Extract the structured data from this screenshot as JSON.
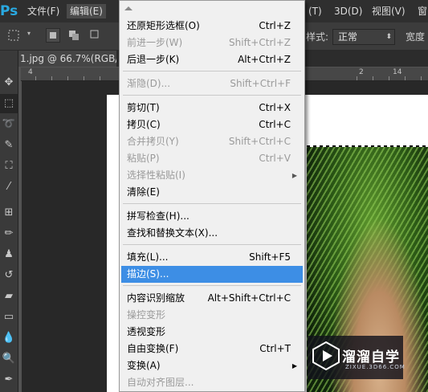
{
  "app": {
    "logo": "Ps",
    "menubar": [
      {
        "label": "文件(F)",
        "active": false
      },
      {
        "label": "编辑(E)",
        "active": true
      },
      {
        "label": "(T)",
        "active": false
      },
      {
        "label": "3D(D)",
        "active": false
      },
      {
        "label": "视图(V)",
        "active": false
      },
      {
        "label": "窗",
        "active": false
      }
    ]
  },
  "options_bar": {
    "style_label": "样式:",
    "style_value": "正常",
    "width_label": "宽度"
  },
  "document": {
    "tab_title": "1.jpg @ 66.7%(RGB/"
  },
  "ruler": {
    "numbers": [
      "4",
      "2",
      "14"
    ]
  },
  "edit_menu": {
    "items": [
      {
        "label": "还原矩形选框(O)",
        "shortcut": "Ctrl+Z",
        "disabled": false
      },
      {
        "label": "前进一步(W)",
        "shortcut": "Shift+Ctrl+Z",
        "disabled": true
      },
      {
        "label": "后退一步(K)",
        "shortcut": "Alt+Ctrl+Z",
        "disabled": false
      },
      {
        "label": "渐隐(D)...",
        "shortcut": "Shift+Ctrl+F",
        "disabled": true
      },
      {
        "label": "剪切(T)",
        "shortcut": "Ctrl+X",
        "disabled": false
      },
      {
        "label": "拷贝(C)",
        "shortcut": "Ctrl+C",
        "disabled": false
      },
      {
        "label": "合并拷贝(Y)",
        "shortcut": "Shift+Ctrl+C",
        "disabled": true
      },
      {
        "label": "粘贴(P)",
        "shortcut": "Ctrl+V",
        "disabled": true
      },
      {
        "label": "选择性粘贴(I)",
        "shortcut": "",
        "disabled": true,
        "submenu": true
      },
      {
        "label": "清除(E)",
        "shortcut": "",
        "disabled": false
      },
      {
        "label": "拼写检查(H)...",
        "shortcut": "",
        "disabled": false
      },
      {
        "label": "查找和替换文本(X)...",
        "shortcut": "",
        "disabled": false
      },
      {
        "label": "填充(L)...",
        "shortcut": "Shift+F5",
        "disabled": false
      },
      {
        "label": "描边(S)...",
        "shortcut": "",
        "disabled": false,
        "highlighted": true
      },
      {
        "label": "内容识别缩放",
        "shortcut": "Alt+Shift+Ctrl+C",
        "disabled": false
      },
      {
        "label": "操控变形",
        "shortcut": "",
        "disabled": true
      },
      {
        "label": "透视变形",
        "shortcut": "",
        "disabled": false
      },
      {
        "label": "自由变换(F)",
        "shortcut": "Ctrl+T",
        "disabled": false
      },
      {
        "label": "变换(A)",
        "shortcut": "",
        "disabled": false,
        "submenu": true
      },
      {
        "label": "自动对齐图层...",
        "shortcut": "",
        "disabled": true
      }
    ]
  },
  "watermark": {
    "title": "溜溜自学",
    "subtitle": "ZIXUE.3D66.COM"
  },
  "colors": {
    "menu_highlight": "#3d8ee5",
    "ps_blue": "#29a9e1"
  }
}
